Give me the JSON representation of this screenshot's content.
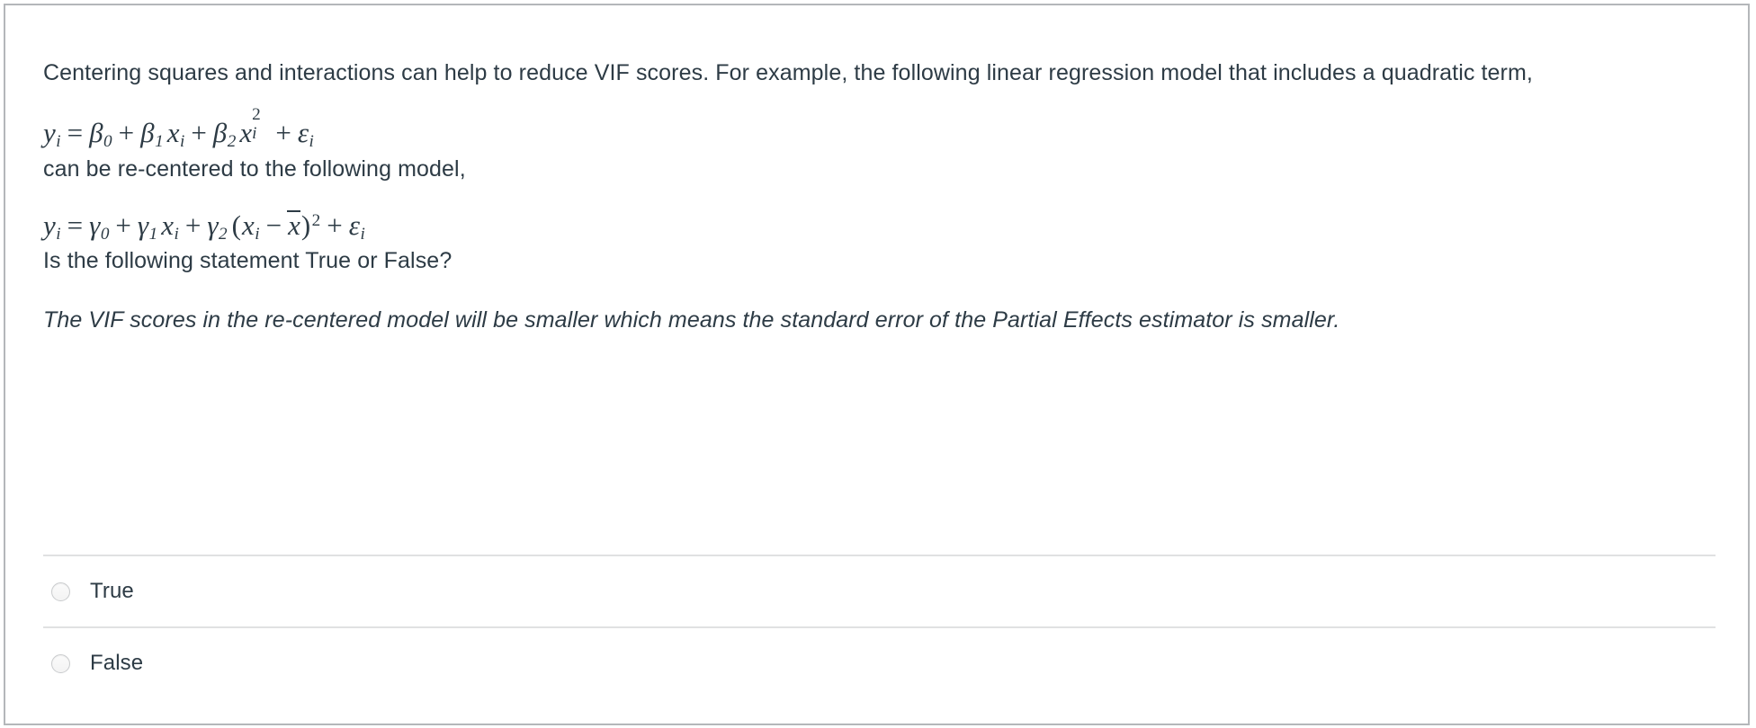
{
  "question": {
    "intro_paragraph": "Centering squares and interactions can help to reduce VIF scores. For example, the following linear regression model that includes a quadratic term,",
    "transition_paragraph": "can be re-centered to the following model,",
    "prompt_paragraph": "Is the following statement True or False?",
    "statement": "The VIF scores in the re-centered model will be smaller which means the standard error of the Partial Effects estimator is smaller.",
    "equation_1": {
      "plain": "y_i = β0 + β1 x_i + β2 x_i^2 + ε_i",
      "lhs_var": "y",
      "lhs_sub": "i",
      "equals": "=",
      "term1_greek": "β",
      "term1_sub": "0",
      "plus": "+",
      "term2_greek": "β",
      "term2_sub": "1",
      "term2_var": "x",
      "term2_varsub": "i",
      "term3_greek": "β",
      "term3_sub": "2",
      "term3_var": "x",
      "term3_varsub": "i",
      "term3_sup": "2",
      "err_greek": "ε",
      "err_sub": "i"
    },
    "equation_2": {
      "plain": "y_i = γ0 + γ1 x_i + γ2 (x_i − x̄)^2 + ε_i",
      "lhs_var": "y",
      "lhs_sub": "i",
      "equals": "=",
      "term1_greek": "γ",
      "term1_sub": "0",
      "plus": "+",
      "term2_greek": "γ",
      "term2_sub": "1",
      "term2_var": "x",
      "term2_varsub": "i",
      "term3_greek": "γ",
      "term3_sub": "2",
      "open_paren": "(",
      "inner_var": "x",
      "inner_sub": "i",
      "minus": "−",
      "mean_var": "x",
      "close_paren": ")",
      "term3_sup": "2",
      "err_greek": "ε",
      "err_sub": "i"
    }
  },
  "answers": [
    {
      "label": "True",
      "selected": false
    },
    {
      "label": "False",
      "selected": false
    }
  ],
  "colors": {
    "text": "#2d3b45",
    "card_border": "#b4b7ba",
    "divider": "#e0e1e2",
    "radio_border": "#c9cbcd",
    "background": "#ffffff"
  }
}
